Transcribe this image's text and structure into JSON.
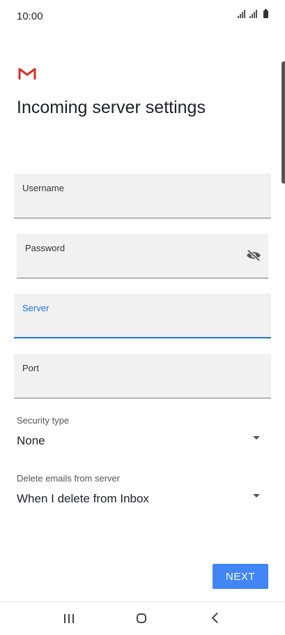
{
  "status": {
    "time": "10:00",
    "icons": [
      "signal-icon",
      "signal-icon",
      "battery-icon"
    ]
  },
  "page": {
    "title": "Incoming server settings",
    "logo": "gmail-icon"
  },
  "fields": {
    "username": {
      "label": "Username",
      "value": ""
    },
    "password": {
      "label": "Password",
      "value": "",
      "icon": "visibility-off-icon"
    },
    "server": {
      "label": "Server",
      "value": ""
    },
    "port": {
      "label": "Port",
      "value": ""
    }
  },
  "selects": {
    "security": {
      "label": "Security type",
      "value": "None"
    },
    "delete": {
      "label": "Delete emails from server",
      "value": "When I delete from Inbox"
    }
  },
  "actions": {
    "next_label": "NEXT"
  },
  "colors": {
    "accent": "#1a73e8",
    "button": "#4285f4",
    "gmail_red": "#d93025",
    "field_bg": "#f1f1f1"
  }
}
